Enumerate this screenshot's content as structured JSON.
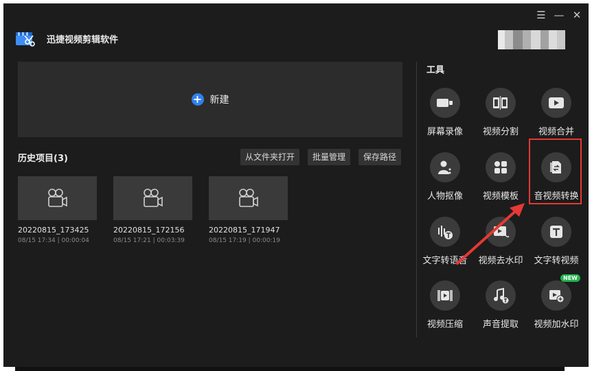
{
  "app": {
    "title": "迅捷视频剪辑软件"
  },
  "window_controls": {
    "menu": "☰",
    "minimize": "—",
    "close": "✕"
  },
  "new_project": {
    "label": "新建"
  },
  "history": {
    "title": "历史项目(3)",
    "buttons": [
      "从文件夹打开",
      "批量管理",
      "保存路径"
    ],
    "projects": [
      {
        "name": "20220815_173425",
        "meta": "08/15 17:34 | 00:00:04"
      },
      {
        "name": "20220815_172156",
        "meta": "08/15 17:21 | 00:03:39"
      },
      {
        "name": "20220815_171947",
        "meta": "08/15 17:19 | 00:00:19"
      }
    ]
  },
  "tools": {
    "title": "工具",
    "items": [
      {
        "label": "屏幕录像",
        "icon": "camera-icon"
      },
      {
        "label": "视频分割",
        "icon": "film-split-icon"
      },
      {
        "label": "视频合并",
        "icon": "play-merge-icon"
      },
      {
        "label": "人物抠像",
        "icon": "person-matting-icon"
      },
      {
        "label": "视频模板",
        "icon": "template-icon"
      },
      {
        "label": "音视频转换",
        "icon": "convert-icon"
      },
      {
        "label": "文字转语音",
        "icon": "text-to-speech-icon"
      },
      {
        "label": "视频去水印",
        "icon": "remove-watermark-icon"
      },
      {
        "label": "文字转视频",
        "icon": "text-to-video-icon"
      },
      {
        "label": "视频压缩",
        "icon": "compress-icon"
      },
      {
        "label": "声音提取",
        "icon": "audio-extract-icon"
      },
      {
        "label": "视频加水印",
        "icon": "add-watermark-icon",
        "badge": "NEW"
      }
    ]
  },
  "colors": {
    "accent": "#2f80ed",
    "highlight": "#e53935",
    "badge": "#22b14c"
  }
}
